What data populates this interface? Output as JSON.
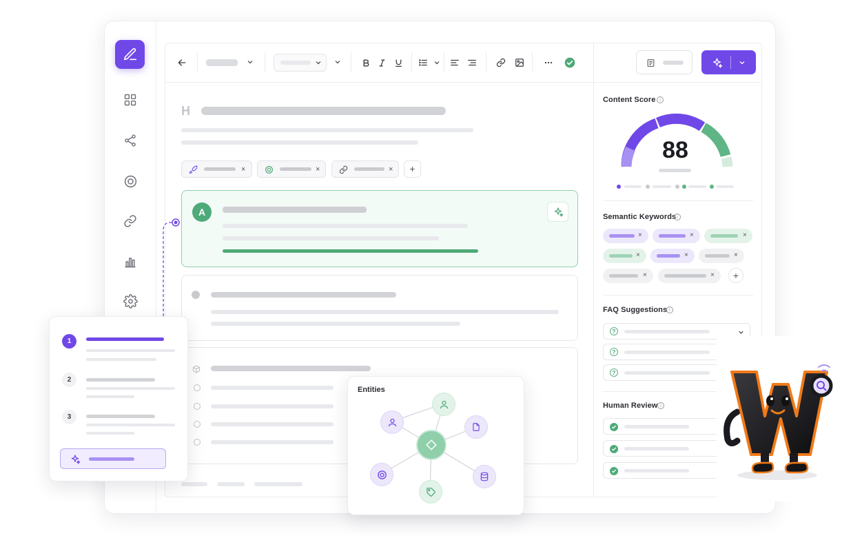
{
  "right_panel": {
    "content_score": {
      "title": "Content Score",
      "score": "88",
      "gauge_fraction": 0.88
    },
    "semantic_keywords": {
      "title": "Semantic Keywords"
    },
    "faq_suggestions": {
      "title": "FAQ Suggestions"
    },
    "human_review": {
      "title": "Human Review"
    }
  },
  "editor": {
    "heading_marker": "H",
    "active_card_avatar": "A",
    "close_glyph": "×",
    "add_glyph": "+"
  },
  "steps_panel": {
    "steps": [
      {
        "number": "1",
        "state": "active"
      },
      {
        "number": "2",
        "state": "pending"
      },
      {
        "number": "3",
        "state": "pending"
      }
    ]
  },
  "entities_panel": {
    "title": "Entities"
  },
  "colors": {
    "accent_purple": "#7048e8",
    "accent_green": "#4eaa78",
    "light_purple": "#ece7fb",
    "light_green": "#e3f3ea"
  },
  "icons": {
    "sidebar": [
      "edit-icon",
      "grid-icon",
      "share-icon",
      "target-icon",
      "link-icon",
      "bar-chart-icon",
      "settings-icon"
    ],
    "toolbar": [
      "back-arrow-icon",
      "bold-icon",
      "italic-icon",
      "underline-icon",
      "list-icon",
      "align-left-icon",
      "align-right-icon",
      "link-icon",
      "image-icon",
      "more-icon",
      "check-circle-icon"
    ]
  }
}
